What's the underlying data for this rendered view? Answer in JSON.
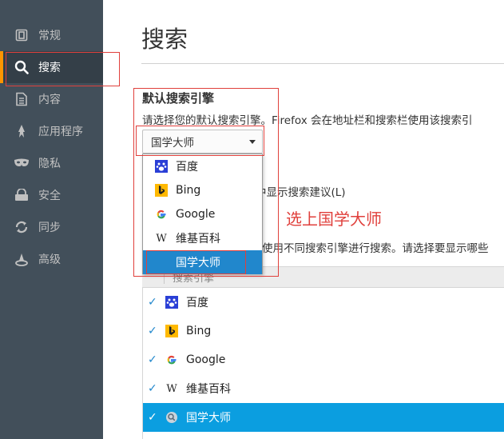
{
  "sidebar": {
    "items": [
      {
        "label": "常规",
        "icon": "general-icon"
      },
      {
        "label": "搜索",
        "icon": "search-icon"
      },
      {
        "label": "内容",
        "icon": "content-icon"
      },
      {
        "label": "应用程序",
        "icon": "applications-icon"
      },
      {
        "label": "隐私",
        "icon": "privacy-mask-icon"
      },
      {
        "label": "安全",
        "icon": "security-icon"
      },
      {
        "label": "同步",
        "icon": "sync-icon"
      },
      {
        "label": "高级",
        "icon": "advanced-icon"
      }
    ],
    "active_index": 1
  },
  "main": {
    "title": "搜索",
    "default_engine": {
      "heading": "默认搜索引擎",
      "description": "请选择您的默认搜索引擎。Firefox 会在地址栏和搜索栏使用该搜索引",
      "selected": "国学大师"
    },
    "suggestion_text": "中显示搜索建议(L)",
    "oneclick_text": "使用不同搜索引擎进行搜索。请选择要显示哪些"
  },
  "popup": {
    "options": [
      {
        "label": "百度",
        "icon": "baidu-paw-icon"
      },
      {
        "label": "Bing",
        "icon": "bing-icon"
      },
      {
        "label": "Google",
        "icon": "google-icon"
      },
      {
        "label": "维基百科",
        "icon": "wikipedia-icon"
      },
      {
        "label": "国学大师",
        "icon": "",
        "selected": true
      }
    ]
  },
  "annotation": {
    "text": "选上国学大师",
    "color": "#e0403c"
  },
  "table": {
    "column_header": "搜索引擎",
    "rows": [
      {
        "label": "百度",
        "icon": "baidu-paw-icon",
        "checked": true
      },
      {
        "label": "Bing",
        "icon": "bing-icon",
        "checked": true
      },
      {
        "label": "Google",
        "icon": "google-icon",
        "checked": true
      },
      {
        "label": "维基百科",
        "icon": "wikipedia-icon",
        "checked": true
      },
      {
        "label": "国学大师",
        "icon": "magnifier-icon",
        "checked": true,
        "selected": true
      }
    ]
  },
  "colors": {
    "sidebar_bg": "#424f5a",
    "active_accent": "#ff9500",
    "popup_highlight": "#2187cc",
    "row_highlight": "#0b9ee0"
  }
}
